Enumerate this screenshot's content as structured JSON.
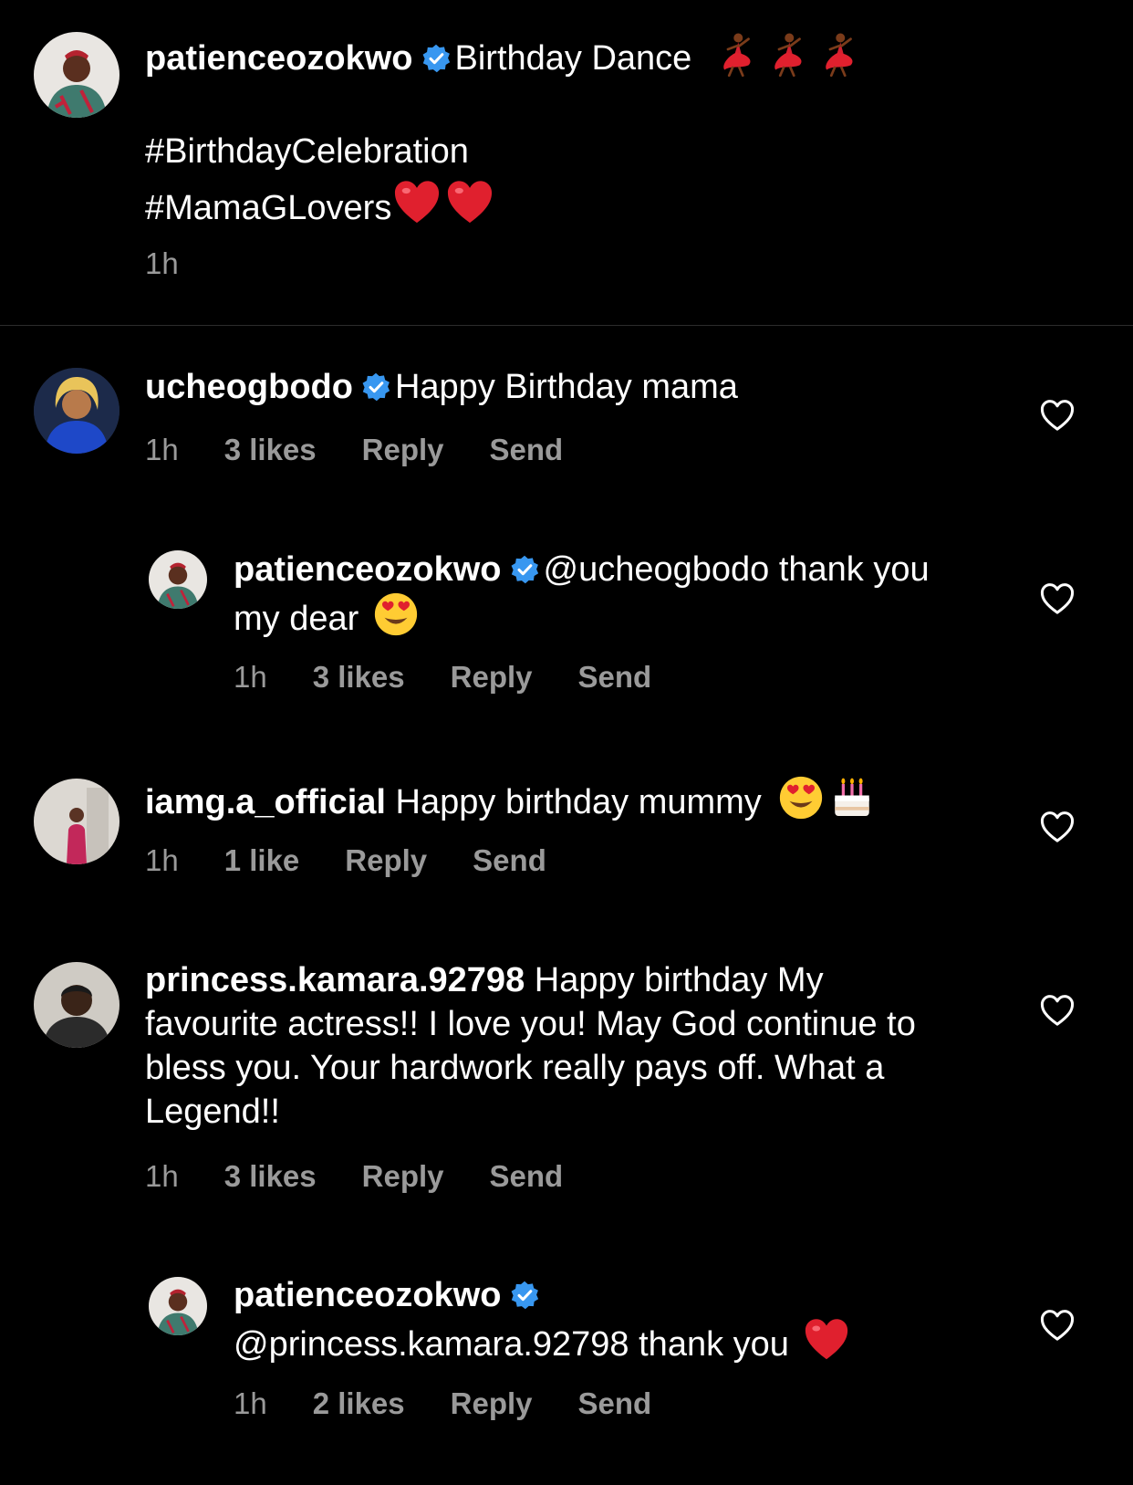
{
  "caption": {
    "username": "patienceozokwo",
    "text": "Birthday Dance",
    "hashtag_1": "#BirthdayCelebration",
    "hashtag_2": "#MamaGLovers",
    "time": "1h"
  },
  "comments": [
    {
      "username": "ucheogbodo",
      "verified": true,
      "text": "Happy Birthday mama",
      "time": "1h",
      "likes": "3 likes",
      "reply": "Reply",
      "send": "Send"
    },
    {
      "username": "patienceozokwo",
      "verified": true,
      "text": "@ucheogbodo thank you my dear",
      "time": "1h",
      "likes": "3 likes",
      "reply": "Reply",
      "send": "Send"
    },
    {
      "username": "iamg.a_official",
      "verified": false,
      "text": "Happy birthday mummy",
      "time": "1h",
      "likes": "1 like",
      "reply": "Reply",
      "send": "Send"
    },
    {
      "username": "princess.kamara.92798",
      "verified": false,
      "text": "Happy birthday My favourite actress!! I love you! May God continue to bless you. Your hardwork really pays off. What a Legend!!",
      "time": "1h",
      "likes": "3 likes",
      "reply": "Reply",
      "send": "Send"
    },
    {
      "username": "patienceozokwo",
      "verified": true,
      "text": "@princess.kamara.92798 thank you",
      "time": "1h",
      "likes": "2 likes",
      "reply": "Reply",
      "send": "Send"
    }
  ],
  "icons": {
    "verified": "verified-badge-icon",
    "like": "heart-outline-icon",
    "dancer": "dancer-emoji-icon",
    "red_heart": "red-heart-emoji-icon",
    "heart_eyes": "heart-eyes-emoji-icon",
    "cake": "birthday-cake-emoji-icon"
  },
  "colors": {
    "background": "#000000",
    "text": "#ffffff",
    "secondary_text": "#9a9a9a",
    "verified": "#3897f0",
    "divider": "#2c2c2c",
    "heart_red": "#e0202e"
  }
}
